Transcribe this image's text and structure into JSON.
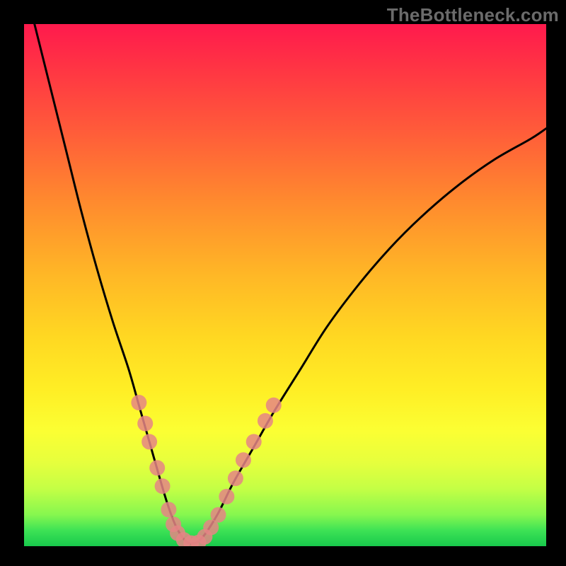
{
  "watermark": {
    "text": "TheBottleneck.com"
  },
  "chart_data": {
    "type": "line",
    "title": "",
    "xlabel": "",
    "ylabel": "",
    "xlim": [
      0,
      100
    ],
    "ylim": [
      0,
      100
    ],
    "grid": false,
    "legend": false,
    "annotations": [],
    "gradient_stops": [
      {
        "pct": 0,
        "color": "#ff1a4d"
      },
      {
        "pct": 20,
        "color": "#ff5a3a"
      },
      {
        "pct": 48,
        "color": "#ffb726"
      },
      {
        "pct": 70,
        "color": "#ffee25"
      },
      {
        "pct": 89,
        "color": "#c4ff45"
      },
      {
        "pct": 100,
        "color": "#18c94c"
      }
    ],
    "series": [
      {
        "name": "bottleneck-curve",
        "color": "#000000",
        "x": [
          2,
          5,
          8,
          11,
          14,
          17,
          20,
          22,
          24,
          26,
          27.5,
          29,
          30.5,
          32,
          34,
          37,
          40,
          44,
          48,
          53,
          58,
          64,
          70,
          76,
          83,
          90,
          97,
          100
        ],
        "y": [
          100,
          88,
          76,
          64,
          53,
          43,
          34,
          27,
          20,
          13,
          8,
          4,
          1.5,
          0.5,
          1.5,
          6,
          12,
          19,
          26,
          34,
          42,
          50,
          57,
          63,
          69,
          74,
          78,
          80
        ]
      }
    ],
    "markers": {
      "name": "highlighted-points",
      "color": "#e58585",
      "radius": 11,
      "points": [
        {
          "x": 22.0,
          "y": 27.5
        },
        {
          "x": 23.2,
          "y": 23.5
        },
        {
          "x": 24.0,
          "y": 20.0
        },
        {
          "x": 25.5,
          "y": 15.0
        },
        {
          "x": 26.5,
          "y": 11.5
        },
        {
          "x": 27.7,
          "y": 7.0
        },
        {
          "x": 28.6,
          "y": 4.2
        },
        {
          "x": 29.4,
          "y": 2.5
        },
        {
          "x": 30.6,
          "y": 1.2
        },
        {
          "x": 32.0,
          "y": 0.6
        },
        {
          "x": 33.4,
          "y": 0.7
        },
        {
          "x": 34.6,
          "y": 1.8
        },
        {
          "x": 35.8,
          "y": 3.6
        },
        {
          "x": 37.2,
          "y": 6.0
        },
        {
          "x": 38.8,
          "y": 9.5
        },
        {
          "x": 40.5,
          "y": 13.0
        },
        {
          "x": 42.0,
          "y": 16.5
        },
        {
          "x": 44.0,
          "y": 20.0
        },
        {
          "x": 46.2,
          "y": 24.0
        },
        {
          "x": 47.8,
          "y": 27.0
        }
      ]
    }
  }
}
